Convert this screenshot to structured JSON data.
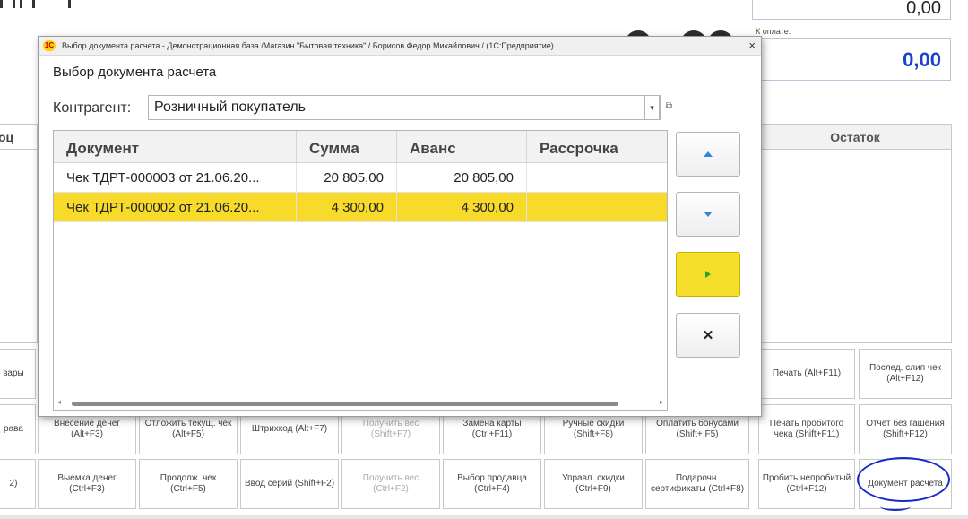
{
  "workplace": {
    "total_top": "0,00",
    "to_pay_label": "К оплате:",
    "to_pay_value": "0,00",
    "left_column_header": "оц",
    "right_column_header": "Остаток",
    "function_keys": [
      {
        "label": "вары"
      },
      {
        "label": "Печать (Alt+F11)"
      },
      {
        "label": "Послед. слип чек (Alt+F12)"
      },
      {
        "label": "рава"
      },
      {
        "label": "Внесение денег (Alt+F3)"
      },
      {
        "label": "Отложить текущ. чек (Alt+F5)"
      },
      {
        "label": "Штрихкод (Alt+F7)"
      },
      {
        "label": "Получить вес (Shift+F7)"
      },
      {
        "label": "Замена карты (Ctrl+F11)"
      },
      {
        "label": "Ручные скидки (Shift+F8)"
      },
      {
        "label": "Оплатить бонусами (Shift+ F5)"
      },
      {
        "label": "Печать пробитого чека (Shift+F11)"
      },
      {
        "label": "Отчет без гашения (Shift+F12)"
      },
      {
        "label": "2)"
      },
      {
        "label": "Выемка денег (Ctrl+F3)"
      },
      {
        "label": "Продолж. чек (Ctrl+F5)"
      },
      {
        "label": "Ввод серий (Shift+F2)"
      },
      {
        "label": "Получить вес (Ctrl+F2)"
      },
      {
        "label": "Выбор продавца (Ctrl+F4)"
      },
      {
        "label": "Управл. скидки (Ctrl+F9)"
      },
      {
        "label": "Подарочн. сертификаты (Ctrl+F8)"
      },
      {
        "label": "Пробить непробитый (Ctrl+F12)"
      },
      {
        "label": "Документ расчета"
      }
    ]
  },
  "dialog": {
    "window_title": "Выбор документа расчета - Демонстрационная база /Магазин \"Бытовая техника\" / Борисов Федор Михайлович / (1С:Предприятие)",
    "app_logo": "1С",
    "close_glyph": "×",
    "heading": "Выбор документа расчета",
    "counterparty_label": "Контрагент:",
    "counterparty_value": "Розничный покупатель",
    "dropdown_glyph": "▾",
    "open_glyph": "⧉",
    "columns": [
      "Документ",
      "Сумма",
      "Аванс",
      "Рассрочка"
    ],
    "rows": [
      {
        "document": "Чек ТДРТ-000003 от 21.06.20...",
        "sum": "20 805,00",
        "advance": "20 805,00",
        "installment": "",
        "selected": false
      },
      {
        "document": "Чек ТДРТ-000002 от 21.06.20...",
        "sum": "4 300,00",
        "advance": "4 300,00",
        "installment": "",
        "selected": true
      }
    ],
    "scroll_left_glyph": "◂",
    "scroll_right_glyph": "▸",
    "cancel_glyph": "✕",
    "colors": {
      "selected_row": "#f8da2b",
      "primary_button": "#f5df2a",
      "accent_blue": "#1a43c8"
    }
  }
}
